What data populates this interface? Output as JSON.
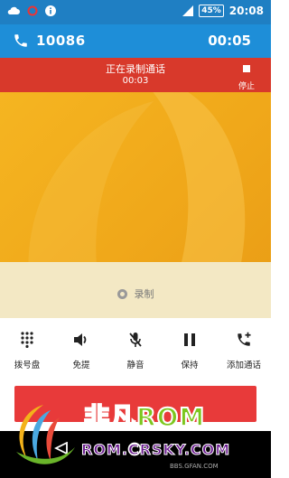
{
  "status_bar": {
    "time": "20:08",
    "battery": "45%",
    "icons": [
      "cloud-icon",
      "alert-ring-icon",
      "info-icon",
      "signal-icon",
      "battery-icon"
    ]
  },
  "call": {
    "number": "10086",
    "duration": "00:05"
  },
  "recording": {
    "title": "正在录制通话",
    "time": "00:03",
    "stop_label": "停止"
  },
  "record_toggle": {
    "label": "录制"
  },
  "controls": [
    {
      "label": "拨号盘",
      "icon": "dialpad-icon"
    },
    {
      "label": "免提",
      "icon": "speaker-icon"
    },
    {
      "label": "静音",
      "icon": "mute-mic-icon"
    },
    {
      "label": "保持",
      "icon": "pause-icon"
    },
    {
      "label": "添加通话",
      "icon": "add-call-icon"
    }
  ],
  "watermark": {
    "brand_a": "非凡",
    "brand_b": "ROM",
    "url": "ROM.CRSKY.COM",
    "small": "BBS.GFAN.COM"
  },
  "colors": {
    "status_bar": "#1f7fc3",
    "header": "#1e8ed8",
    "recording": "#d8392b",
    "end_call": "#e83a3a"
  }
}
